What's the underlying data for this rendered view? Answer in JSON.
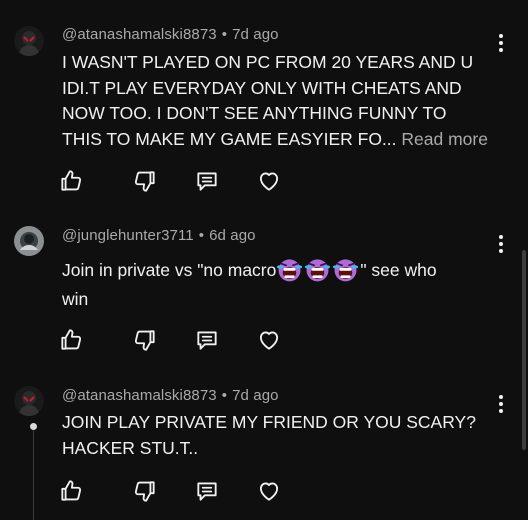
{
  "comments": [
    {
      "author": "@atanashamalski8873",
      "time": "7d ago",
      "lines": [
        "I WASN'T PLAYED ON PC FROM 20 YEARS AND U",
        "IDI.T PLAY EVERYDAY ONLY WITH CHEATS AND",
        "NOW TOO. I DON'T SEE ANYTHING FUNNY TO",
        "THIS TO MAKE MY GAME EASYIER FO..."
      ],
      "read_more": "Read more"
    },
    {
      "author": "@junglehunter3711",
      "time": "6d ago",
      "text_before": "Join in private vs \"no macro",
      "text_after": "\" see who",
      "line2": "win",
      "emoji": [
        "laughing-crying-emoji",
        "laughing-crying-emoji",
        "laughing-crying-emoji"
      ]
    },
    {
      "author": "@atanashamalski8873",
      "time": "7d ago",
      "lines": [
        "JOIN PLAY PRIVATE MY FRIEND OR YOU SCARY?",
        "HACKER STU.T.."
      ]
    }
  ],
  "separator": "•",
  "icons": {
    "like": "thumbs-up-icon",
    "dislike": "thumbs-down-icon",
    "reply": "reply-icon",
    "heart": "heart-icon",
    "more": "more-vertical-icon"
  },
  "colors": {
    "background": "#0f0f0f",
    "text": "#f1f1f1",
    "meta": "#aaaaaa",
    "emoji": "#b06ad8"
  }
}
